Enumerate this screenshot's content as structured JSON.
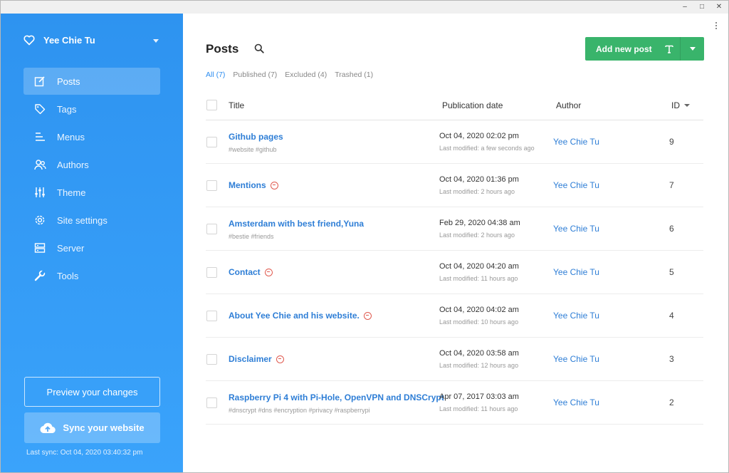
{
  "window": {
    "controls": [
      "–",
      "□",
      "✕"
    ]
  },
  "sidebar": {
    "site_name": "Yee Chie Tu",
    "nav": [
      {
        "label": "Posts",
        "icon": "edit-icon",
        "active": true
      },
      {
        "label": "Tags",
        "icon": "tag-icon",
        "active": false
      },
      {
        "label": "Menus",
        "icon": "menu-icon",
        "active": false
      },
      {
        "label": "Authors",
        "icon": "users-icon",
        "active": false
      },
      {
        "label": "Theme",
        "icon": "sliders-icon",
        "active": false
      },
      {
        "label": "Site settings",
        "icon": "gear-icon",
        "active": false
      },
      {
        "label": "Server",
        "icon": "server-icon",
        "active": false
      },
      {
        "label": "Tools",
        "icon": "wrench-icon",
        "active": false
      }
    ],
    "preview_label": "Preview your changes",
    "sync_label": "Sync your website",
    "last_sync": "Last sync: Oct 04, 2020 03:40:32 pm"
  },
  "main": {
    "title": "Posts",
    "filters": [
      {
        "label": "All (7)",
        "active": true
      },
      {
        "label": "Published (7)",
        "active": false
      },
      {
        "label": "Excluded (4)",
        "active": false
      },
      {
        "label": "Trashed (1)",
        "active": false
      }
    ],
    "add_button_label": "Add new post",
    "table": {
      "headers": {
        "title": "Title",
        "date": "Publication date",
        "author": "Author",
        "id": "ID"
      },
      "rows": [
        {
          "title": "Github pages",
          "excluded": false,
          "tags": "#website  #github",
          "date": "Oct 04, 2020 02:02 pm",
          "modified": "Last modified: a few seconds ago",
          "author": "Yee Chie Tu",
          "id": "9"
        },
        {
          "title": "Mentions",
          "excluded": true,
          "tags": "",
          "date": "Oct 04, 2020 01:36 pm",
          "modified": "Last modified: 2 hours ago",
          "author": "Yee Chie Tu",
          "id": "7"
        },
        {
          "title": "Amsterdam with best friend,Yuna",
          "excluded": false,
          "tags": "#bestie  #friends",
          "date": "Feb 29, 2020 04:38 am",
          "modified": "Last modified: 2 hours ago",
          "author": "Yee Chie Tu",
          "id": "6"
        },
        {
          "title": "Contact",
          "excluded": true,
          "tags": "",
          "date": "Oct 04, 2020 04:20 am",
          "modified": "Last modified: 11 hours ago",
          "author": "Yee Chie Tu",
          "id": "5"
        },
        {
          "title": "About Yee Chie and his website.",
          "excluded": true,
          "tags": "",
          "date": "Oct 04, 2020 04:02 am",
          "modified": "Last modified: 10 hours ago",
          "author": "Yee Chie Tu",
          "id": "4"
        },
        {
          "title": "Disclaimer",
          "excluded": true,
          "tags": "",
          "date": "Oct 04, 2020 03:58 am",
          "modified": "Last modified: 12 hours ago",
          "author": "Yee Chie Tu",
          "id": "3"
        },
        {
          "title": "Raspberry Pi 4 with Pi-Hole, OpenVPN and DNSCrypt",
          "excluded": false,
          "tags": "#dnscrypt  #dns  #encryption  #privacy  #raspberrypi",
          "date": "Apr 07, 2017 03:03 am",
          "modified": "Last modified: 11 hours ago",
          "author": "Yee Chie Tu",
          "id": "2"
        }
      ]
    }
  },
  "colors": {
    "sidebar": "#2e93f0",
    "accent": "#2e7ed6",
    "add_button": "#39b46b",
    "excluded": "#e05a4f"
  }
}
